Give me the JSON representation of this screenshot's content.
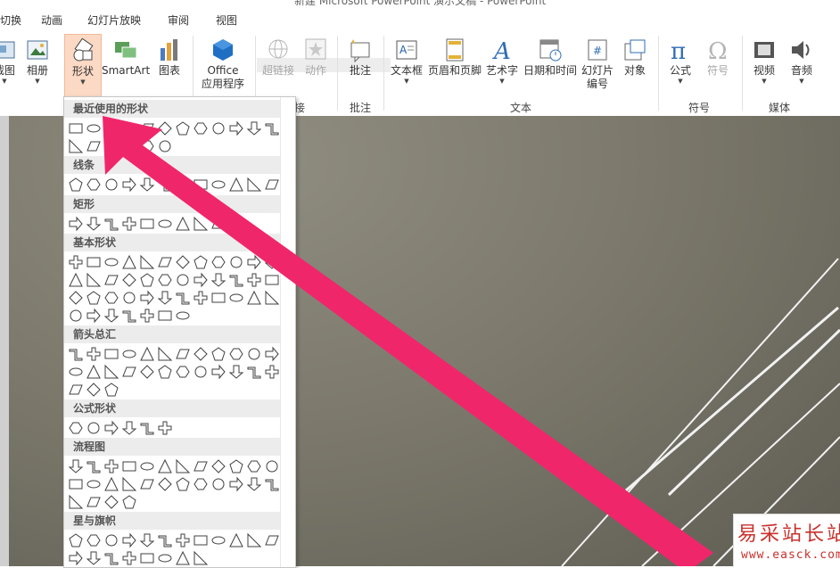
{
  "window": {
    "title": "新建 Microsoft PowerPoint 演示文稿 - PowerPoint"
  },
  "tabs": [
    "切换",
    "动画",
    "幻灯片放映",
    "审阅",
    "视图"
  ],
  "ribbon": {
    "buttons": {
      "screenshot": "截图",
      "album": "相册",
      "shapes": "形状",
      "smartart": "SmartArt",
      "chart": "图表",
      "office_apps_1": "Office",
      "office_apps_2": "应用程序",
      "hyperlink": "超链接",
      "action": "动作",
      "comment": "批注",
      "textbox": "文本框",
      "header_footer": "页眉和页脚",
      "wordart": "艺术字",
      "datetime": "日期和时间",
      "slide_number_1": "幻灯片",
      "slide_number_2": "编号",
      "object": "对象",
      "equation": "公式",
      "symbol": "符号",
      "video": "视频",
      "audio": "音频"
    },
    "groups": {
      "links": "接",
      "comments": "批注",
      "text": "文本",
      "symbols": "符号",
      "media": "媒体"
    }
  },
  "gallery": {
    "sections": [
      "最近使用的形状",
      "线条",
      "矩形",
      "基本形状",
      "箭头总汇",
      "公式形状",
      "流程图",
      "星与旗帜"
    ],
    "icons": {
      "recent": "recently-used-shape-icons",
      "lines": "line-shape-icons",
      "rect": "rectangle-shape-icons",
      "basic": "basic-shape-icons",
      "arrows": "block-arrow-icons",
      "equation": "equation-shape-icons",
      "flowchart": "flowchart-shape-icons",
      "stars": "star-and-banner-icons"
    }
  },
  "watermark": {
    "title": "易采站长站",
    "url": "www.easck.com"
  },
  "colors": {
    "accent_arrow": "#f0266b",
    "active_button": "#fbd9c4",
    "slide_bg": "#7d7a6d",
    "watermark_text": "#c8302c"
  }
}
